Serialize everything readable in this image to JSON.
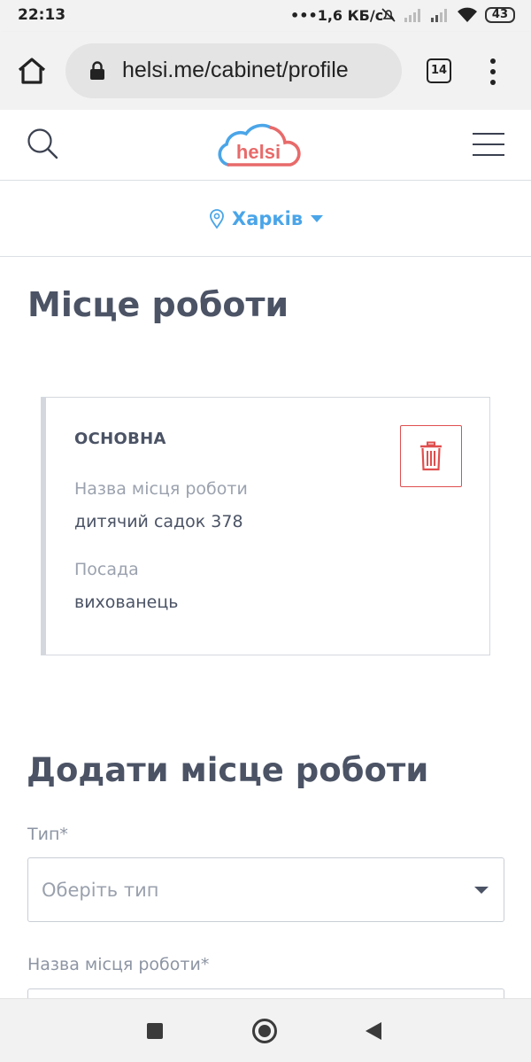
{
  "status_bar": {
    "time": "22:13",
    "network_speed": "1,6 КБ/с",
    "battery": "43",
    "icons": [
      "dots-icon",
      "muted-icon",
      "signal-icon",
      "signal-icon",
      "wifi-icon",
      "battery-icon"
    ]
  },
  "browser": {
    "url": "helsi.me/cabinet/profile",
    "tab_count": "14",
    "icons": [
      "home-icon",
      "lock-icon",
      "tabs-icon",
      "menu-dots-icon"
    ]
  },
  "header": {
    "logo_text": "helsi",
    "city": "Харків",
    "icons": [
      "search-icon",
      "logo",
      "hamburger-menu-icon",
      "location-pin-icon",
      "caret-down-icon"
    ],
    "colors": {
      "accent_blue": "#4aa5e8",
      "brand_red": "#e86a6a"
    }
  },
  "main": {
    "page_title": "Місце роботи",
    "workplace": {
      "type": "ОСНОВНА",
      "name_label": "Назва місця роботи",
      "name_value": "дитячий садок 378",
      "position_label": "Посада",
      "position_value": "вихованець",
      "delete_icon": "trash-icon",
      "delete_color": "#e04f4f"
    },
    "add_form": {
      "title": "Додати місце роботи",
      "type_label": "Тип*",
      "type_placeholder": "Оберіть тип",
      "name_label": "Назва місця роботи*"
    }
  },
  "nav_bar": {
    "icons": [
      "recents-square-icon",
      "home-circle-icon",
      "back-triangle-icon"
    ]
  }
}
